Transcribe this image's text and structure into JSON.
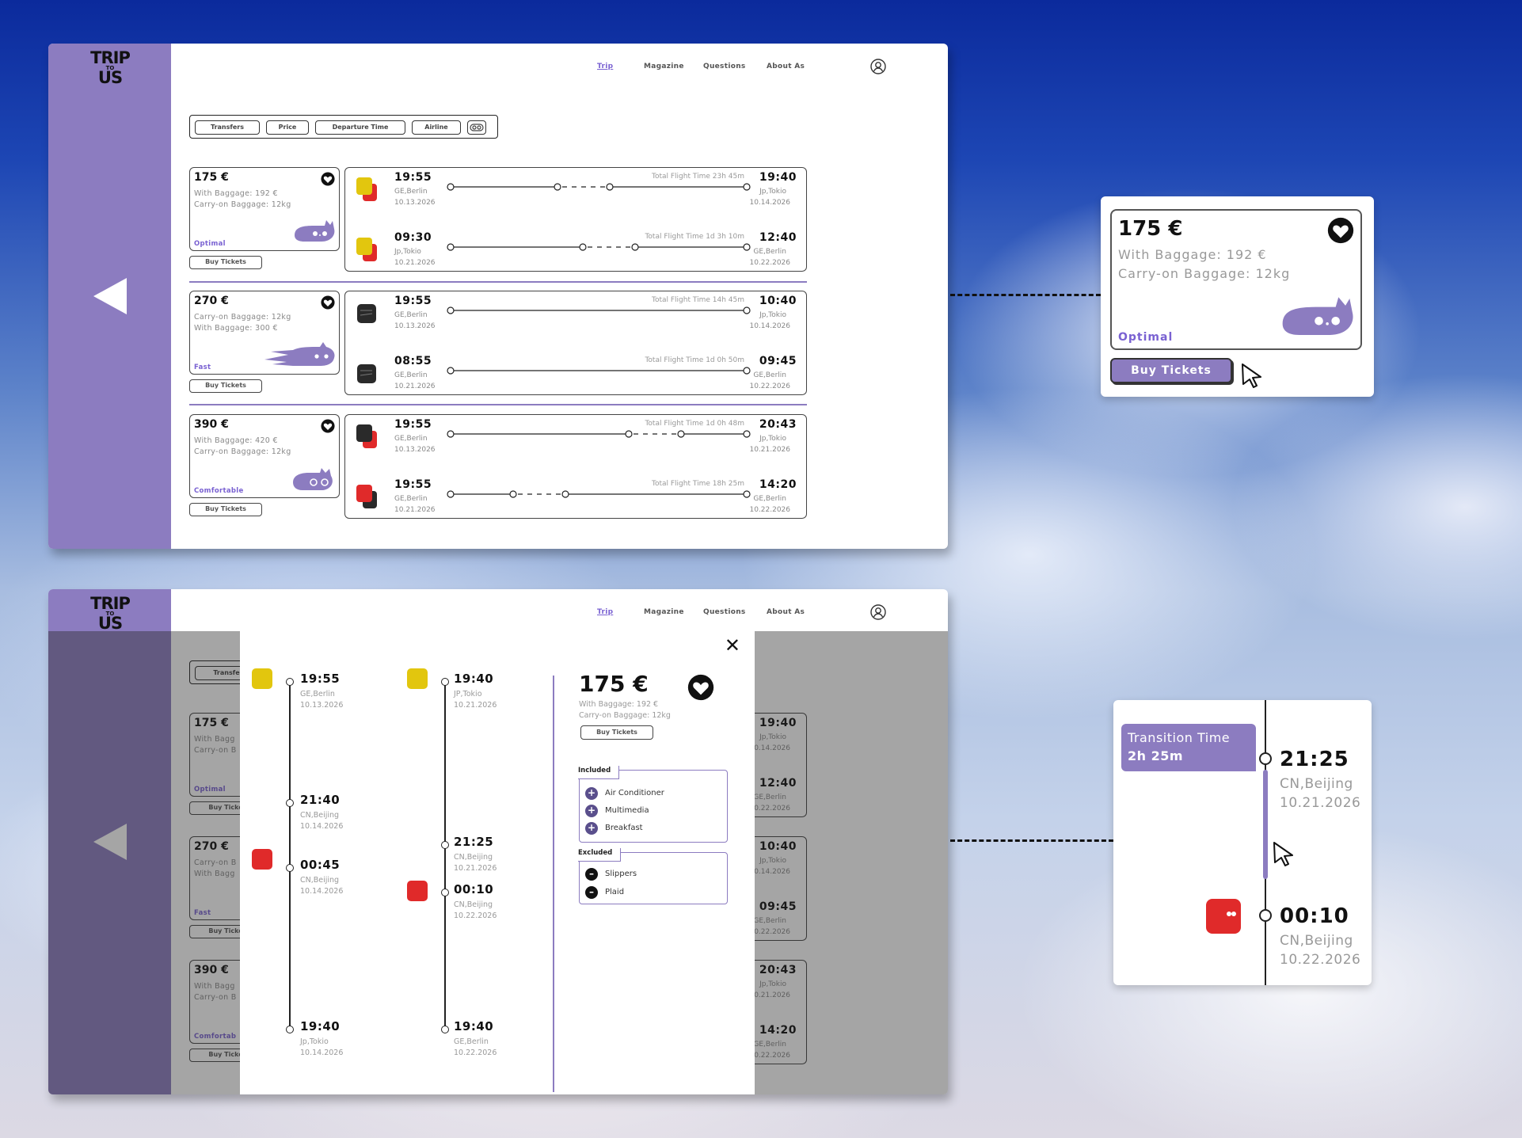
{
  "brand": {
    "logo_top": "TRIP",
    "logo_mid": "TO",
    "logo_bottom": "US"
  },
  "nav": {
    "trip": "Trip",
    "magazine": "Magazine",
    "questions": "Questions",
    "about": "About As"
  },
  "filters": {
    "transfers": "Transfers",
    "price": "Price",
    "departure_time": "Departure Time",
    "airline": "Airline"
  },
  "colors": {
    "accent": "#8c7cc0",
    "accent_text": "#7a62d2",
    "yellow_airline": "#e2c60e",
    "red_airline": "#e02a2a",
    "dark_airline": "#2a2a2a"
  },
  "offers": [
    {
      "price": "175 €",
      "line1": "With Baggage: 192 €",
      "line2": "Carry-on Baggage: 12kg",
      "tag": "Optimal",
      "buy": "Buy Tickets",
      "legs": [
        {
          "dep_time": "19:55",
          "dep_city": "GE,Berlin",
          "dep_date": "10.13.2026",
          "total": "Total Flight Time 23h 45m",
          "arr_time": "19:40",
          "arr_city": "Jp,Tokio",
          "arr_date": "10.14.2026",
          "airline": "yellow-red"
        },
        {
          "dep_time": "09:30",
          "dep_city": "Jp,Tokio",
          "dep_date": "10.21.2026",
          "total": "Total Flight Time 1d 3h 10m",
          "arr_time": "12:40",
          "arr_city": "GE,Berlin",
          "arr_date": "10.22.2026",
          "airline": "yellow-red"
        }
      ]
    },
    {
      "price": "270 €",
      "line1": "Carry-on Baggage: 12kg",
      "line2": "With Baggage: 300 €",
      "tag": "Fast",
      "buy": "Buy Tickets",
      "legs": [
        {
          "dep_time": "19:55",
          "dep_city": "GE,Berlin",
          "dep_date": "10.13.2026",
          "total": "Total Flight Time 14h 45m",
          "arr_time": "10:40",
          "arr_city": "Jp,Tokio",
          "arr_date": "10.14.2026",
          "airline": "dark"
        },
        {
          "dep_time": "08:55",
          "dep_city": "GE,Berlin",
          "dep_date": "10.21.2026",
          "total": "Total Flight Time 1d 0h 50m",
          "arr_time": "09:45",
          "arr_city": "GE,Berlin",
          "arr_date": "10.22.2026",
          "airline": "dark"
        }
      ]
    },
    {
      "price": "390 €",
      "line1": "With Baggage: 420 €",
      "line2": "Carry-on Baggage: 12kg",
      "tag": "Comfortable",
      "buy": "Buy Tickets",
      "legs": [
        {
          "dep_time": "19:55",
          "dep_city": "GE,Berlin",
          "dep_date": "10.13.2026",
          "total": "Total Flight Time 1d 0h 48m",
          "arr_time": "20:43",
          "arr_city": "Jp,Tokio",
          "arr_date": "10.21.2026",
          "airline": "dark-red"
        },
        {
          "dep_time": "19:55",
          "dep_city": "GE,Berlin",
          "dep_date": "10.21.2026",
          "total": "Total Flight Time 18h 25m",
          "arr_time": "14:20",
          "arr_city": "GE,Berlin",
          "arr_date": "10.22.2026",
          "airline": "red-dark"
        }
      ]
    }
  ],
  "bg_partial": [
    {
      "price": "175 €",
      "line1": "With Bagg",
      "line2": "Carry-on B",
      "tag": "Optimal",
      "buy": "Buy Ticke",
      "t1": "19:40",
      "c1": "Jp,Tokio",
      "d1": "10.14.2026",
      "t2": "12:40",
      "c2": "GE,Berlin",
      "d2": "10.22.2026"
    },
    {
      "price": "270 €",
      "line1": "Carry-on B",
      "line2": "With Bagg",
      "tag": "Fast",
      "buy": "Buy Ticke",
      "t1": "10:40",
      "c1": "Jp,Tokio",
      "d1": "10.14.2026",
      "t2": "09:45",
      "c2": "GE,Berlin",
      "d2": "10.22.2026"
    },
    {
      "price": "390 €",
      "line1": "With Bagg",
      "line2": "Carry-on B",
      "tag": "Comfortab",
      "buy": "Buy Ticke",
      "t1": "20:43",
      "c1": "Jp,Tokio",
      "d1": "10.21.2026",
      "t2": "14:20",
      "c2": "GE,Berlin",
      "d2": "10.22.2026"
    }
  ],
  "bg_filter": "Transfe",
  "detail": {
    "close": "✕",
    "outbound": [
      {
        "time": "19:55",
        "city": "GE,Berlin",
        "date": "10.13.2026"
      },
      {
        "time": "21:40",
        "city": "CN,Beijing",
        "date": "10.14.2026"
      },
      {
        "time": "00:45",
        "city": "CN,Beijing",
        "date": "10.14.2026"
      },
      {
        "time": "19:40",
        "city": "Jp,Tokio",
        "date": "10.14.2026"
      }
    ],
    "return": [
      {
        "time": "19:40",
        "city": "JP,Tokio",
        "date": "10.21.2026"
      },
      {
        "time": "21:25",
        "city": "CN,Beijing",
        "date": "10.21.2026"
      },
      {
        "time": "00:10",
        "city": "CN,Beijing",
        "date": "10.22.2026"
      },
      {
        "time": "19:40",
        "city": "GE,Berlin",
        "date": "10.22.2026"
      }
    ],
    "price": "175 €",
    "line1": "With Baggage: 192 €",
    "line2": "Carry-on Baggage: 12kg",
    "buy": "Buy Tickets",
    "included_label": "Included",
    "included": [
      "Air Conditioner",
      "Multimedia",
      "Breakfast"
    ],
    "excluded_label": "Excluded",
    "excluded": [
      "Slippers",
      "Plaid"
    ]
  },
  "zoom_card": {
    "price": "175 €",
    "line1": "With Baggage: 192 €",
    "line2": "Carry-on Baggage: 12kg",
    "tag": "Optimal",
    "buy": "Buy Tickets"
  },
  "zoom_transition": {
    "label": "Transition Time",
    "duration": "2h 25m",
    "t1": "21:25",
    "c1": "CN,Beijing",
    "d1": "10.21.2026",
    "t2": "00:10",
    "c2": "CN,Beijing",
    "d2": "10.22.2026"
  }
}
